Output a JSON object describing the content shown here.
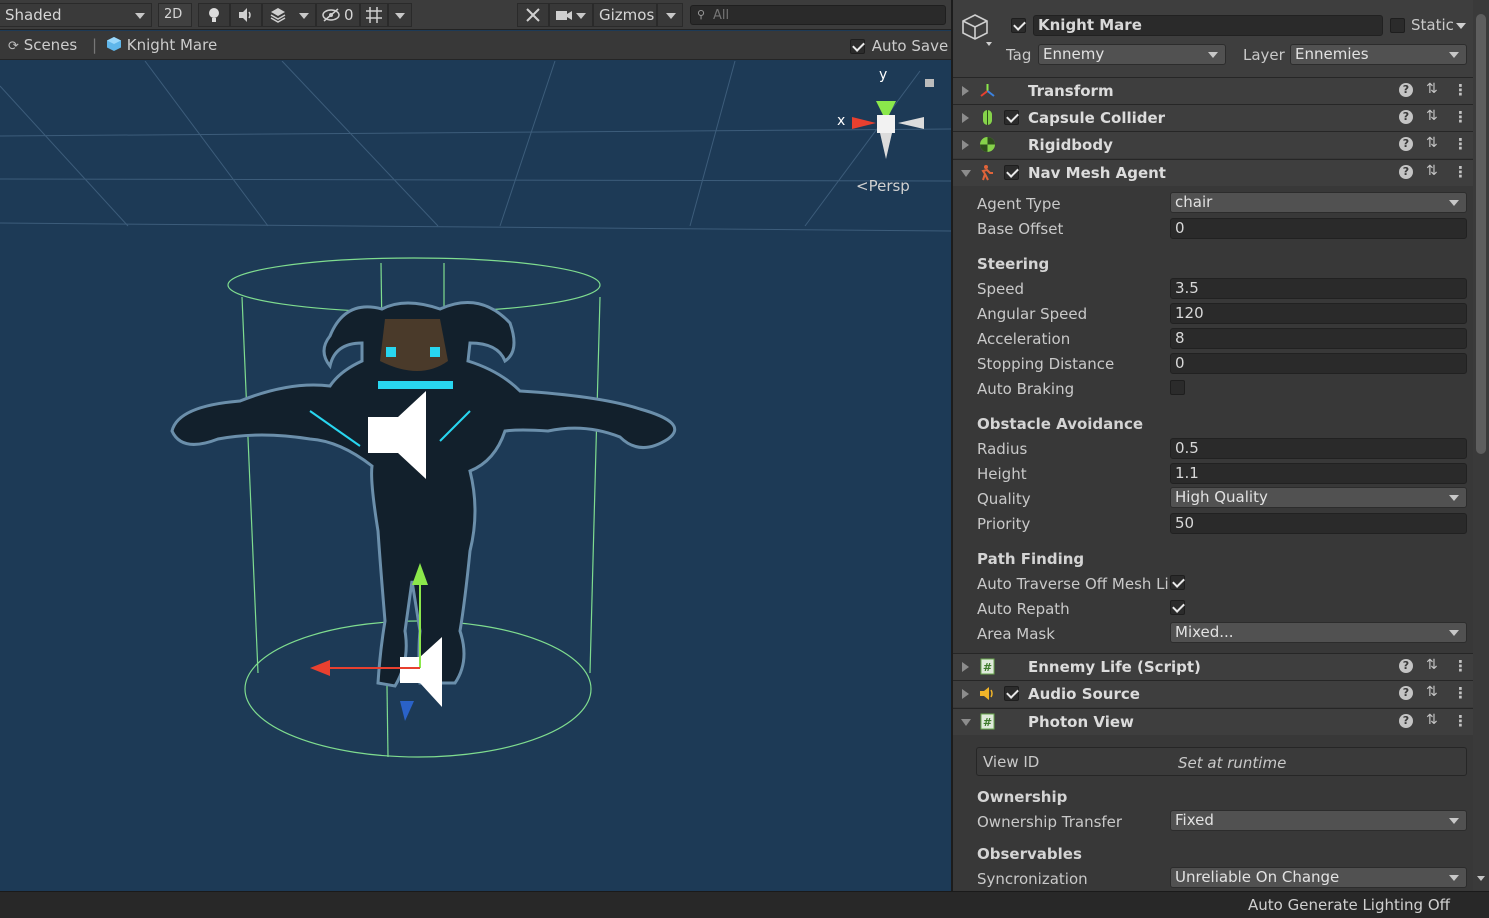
{
  "scene_toolbar": {
    "draw_mode": "Shaded",
    "toggle_2d": "2D",
    "hidden_count": "0",
    "gizmos": "Gizmos",
    "search_placeholder": "All"
  },
  "breadcrumb": {
    "scenes": "Scenes",
    "object": "Knight Mare",
    "auto_save_label": "Auto Save",
    "auto_save_checked": true
  },
  "viewport": {
    "axis_y": "y",
    "axis_x": "x",
    "projection": "Persp",
    "background_color": "#1d3a56",
    "collider_color": "#7fdc8f"
  },
  "inspector": {
    "object_name": "Knight Mare",
    "static_label": "Static",
    "tag_label": "Tag",
    "tag_value": "Ennemy",
    "layer_label": "Layer",
    "layer_value": "Ennemies",
    "components": [
      {
        "title": "Transform",
        "icon": "transform-icon"
      },
      {
        "title": "Capsule Collider",
        "icon": "capsule-collider-icon"
      },
      {
        "title": "Rigidbody",
        "icon": "rigidbody-icon"
      },
      {
        "title": "Nav Mesh Agent",
        "icon": "nav-mesh-agent-icon"
      },
      {
        "title": "Ennemy Life (Script)",
        "icon": "script-icon"
      },
      {
        "title": "Audio Source",
        "icon": "audio-source-icon"
      },
      {
        "title": "Photon View",
        "icon": "script-icon"
      }
    ],
    "nav_mesh_agent": {
      "agent_type_label": "Agent Type",
      "agent_type": "chair",
      "base_offset_label": "Base Offset",
      "base_offset": "0",
      "steering": "Steering",
      "speed_label": "Speed",
      "speed": "3.5",
      "angular_speed_label": "Angular Speed",
      "angular_speed": "120",
      "acceleration_label": "Acceleration",
      "acceleration": "8",
      "stopping_distance_label": "Stopping Distance",
      "stopping_distance": "0",
      "auto_braking_label": "Auto Braking",
      "auto_braking": false,
      "obstacle_avoidance": "Obstacle Avoidance",
      "radius_label": "Radius",
      "radius": "0.5",
      "height_label": "Height",
      "height": "1.1",
      "quality_label": "Quality",
      "quality": "High Quality",
      "priority_label": "Priority",
      "priority": "50",
      "path_finding": "Path Finding",
      "auto_traverse_label": "Auto Traverse Off Mesh Lir",
      "auto_traverse": true,
      "auto_repath_label": "Auto Repath",
      "auto_repath": true,
      "area_mask_label": "Area Mask",
      "area_mask": "Mixed..."
    },
    "photon_view": {
      "view_id_label": "View ID",
      "view_id_value": "Set at runtime",
      "ownership": "Ownership",
      "ownership_transfer_label": "Ownership Transfer",
      "ownership_transfer": "Fixed",
      "observables": "Observables",
      "syncronization_label": "Syncronization",
      "syncronization": "Unreliable On Change"
    }
  },
  "status_bar": {
    "text": "Auto Generate Lighting Off"
  }
}
